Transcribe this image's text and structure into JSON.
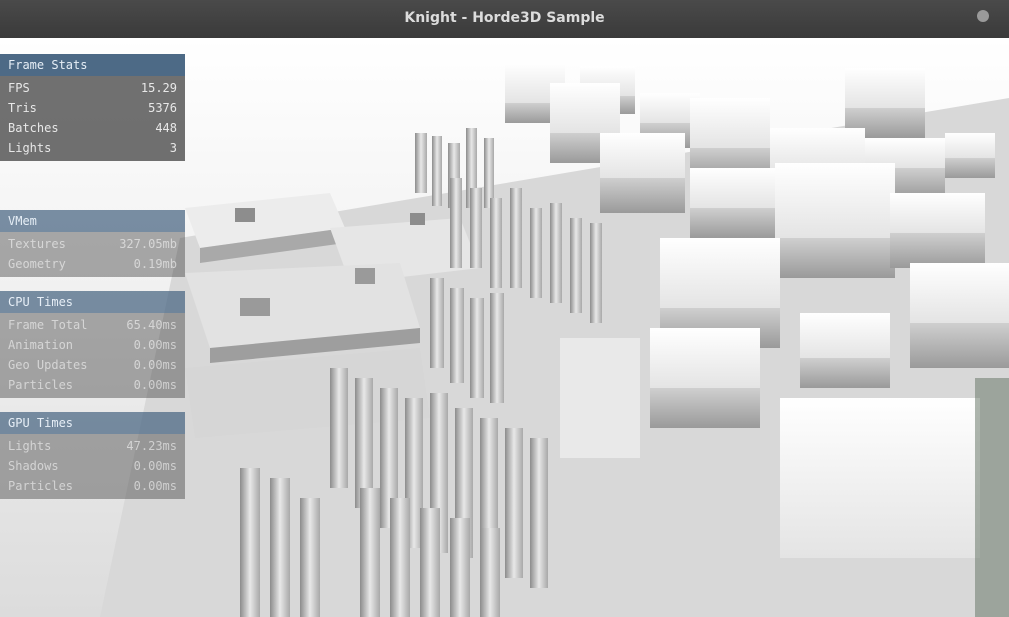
{
  "window": {
    "title": "Knight - Horde3D Sample"
  },
  "frame_stats": {
    "title": "Frame Stats",
    "rows": [
      {
        "label": "FPS",
        "value": "15.29"
      },
      {
        "label": "Tris",
        "value": "5376"
      },
      {
        "label": "Batches",
        "value": "448"
      },
      {
        "label": "Lights",
        "value": "3"
      }
    ]
  },
  "vmem": {
    "title": "VMem",
    "rows": [
      {
        "label": "Textures",
        "value": "327.05mb"
      },
      {
        "label": "Geometry",
        "value": "0.19mb"
      }
    ]
  },
  "cpu_times": {
    "title": "CPU Times",
    "rows": [
      {
        "label": "Frame Total",
        "value": "65.40ms"
      },
      {
        "label": "Animation",
        "value": "0.00ms"
      },
      {
        "label": "Geo Updates",
        "value": "0.00ms"
      },
      {
        "label": "Particles",
        "value": "0.00ms"
      }
    ]
  },
  "gpu_times": {
    "title": "GPU Times",
    "rows": [
      {
        "label": "Lights",
        "value": "47.23ms"
      },
      {
        "label": "Shadows",
        "value": "0.00ms"
      },
      {
        "label": "Particles",
        "value": "0.00ms"
      }
    ]
  }
}
